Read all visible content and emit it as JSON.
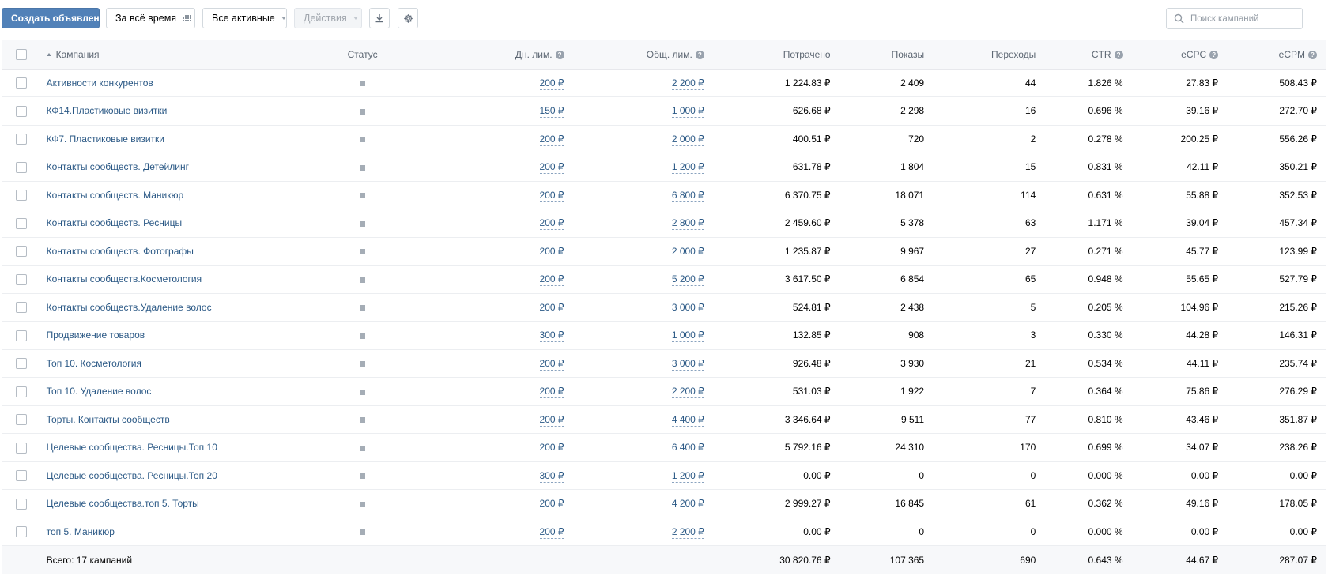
{
  "toolbar": {
    "create_label": "Создать объявление",
    "period_label": "За всё время",
    "filter_label": "Все активные",
    "actions_label": "Действия",
    "search_placeholder": "Поиск кампаний"
  },
  "colors": {
    "primary": "#5181b8",
    "link": "#2a5885",
    "header_bg": "#f7f8fa",
    "status_paused": "#a5adb6"
  },
  "icons": {
    "period": "calendar-grid-icon",
    "download": "download-icon",
    "settings": "gear-icon",
    "search": "search-icon",
    "help": "question-circle-icon",
    "sort": "sort-asc-icon"
  },
  "table": {
    "columns": {
      "campaign": "Кампания",
      "status": "Статус",
      "daily_limit": "Дн. лим.",
      "total_limit": "Общ. лим.",
      "spent": "Потрачено",
      "impressions": "Показы",
      "clicks": "Переходы",
      "ctr": "CTR",
      "ecpc": "eCPC",
      "ecpm": "eCPM"
    },
    "rows": [
      {
        "name": "Активности конкурентов",
        "daily": "200 ₽",
        "total": "2 200 ₽",
        "spent": "1 224.83 ₽",
        "impressions": "2 409",
        "clicks": "44",
        "ctr": "1.826 %",
        "ecpc": "27.83 ₽",
        "ecpm": "508.43 ₽"
      },
      {
        "name": "КФ14.Пластиковые визитки",
        "daily": "150 ₽",
        "total": "1 000 ₽",
        "spent": "626.68 ₽",
        "impressions": "2 298",
        "clicks": "16",
        "ctr": "0.696 %",
        "ecpc": "39.16 ₽",
        "ecpm": "272.70 ₽"
      },
      {
        "name": "КФ7. Пластиковые визитки",
        "daily": "200 ₽",
        "total": "2 000 ₽",
        "spent": "400.51 ₽",
        "impressions": "720",
        "clicks": "2",
        "ctr": "0.278 %",
        "ecpc": "200.25 ₽",
        "ecpm": "556.26 ₽"
      },
      {
        "name": "Контакты сообществ. Детейлинг",
        "daily": "200 ₽",
        "total": "1 200 ₽",
        "spent": "631.78 ₽",
        "impressions": "1 804",
        "clicks": "15",
        "ctr": "0.831 %",
        "ecpc": "42.11 ₽",
        "ecpm": "350.21 ₽"
      },
      {
        "name": "Контакты сообществ. Маникюр",
        "daily": "200 ₽",
        "total": "6 800 ₽",
        "spent": "6 370.75 ₽",
        "impressions": "18 071",
        "clicks": "114",
        "ctr": "0.631 %",
        "ecpc": "55.88 ₽",
        "ecpm": "352.53 ₽"
      },
      {
        "name": "Контакты сообществ. Ресницы",
        "daily": "200 ₽",
        "total": "2 800 ₽",
        "spent": "2 459.60 ₽",
        "impressions": "5 378",
        "clicks": "63",
        "ctr": "1.171 %",
        "ecpc": "39.04 ₽",
        "ecpm": "457.34 ₽"
      },
      {
        "name": "Контакты сообществ. Фотографы",
        "daily": "200 ₽",
        "total": "2 000 ₽",
        "spent": "1 235.87 ₽",
        "impressions": "9 967",
        "clicks": "27",
        "ctr": "0.271 %",
        "ecpc": "45.77 ₽",
        "ecpm": "123.99 ₽"
      },
      {
        "name": "Контакты сообществ.Косметология",
        "daily": "200 ₽",
        "total": "5 200 ₽",
        "spent": "3 617.50 ₽",
        "impressions": "6 854",
        "clicks": "65",
        "ctr": "0.948 %",
        "ecpc": "55.65 ₽",
        "ecpm": "527.79 ₽"
      },
      {
        "name": "Контакты сообществ.Удаление волос",
        "daily": "200 ₽",
        "total": "3 000 ₽",
        "spent": "524.81 ₽",
        "impressions": "2 438",
        "clicks": "5",
        "ctr": "0.205 %",
        "ecpc": "104.96 ₽",
        "ecpm": "215.26 ₽"
      },
      {
        "name": "Продвижение товаров",
        "daily": "300 ₽",
        "total": "1 000 ₽",
        "spent": "132.85 ₽",
        "impressions": "908",
        "clicks": "3",
        "ctr": "0.330 %",
        "ecpc": "44.28 ₽",
        "ecpm": "146.31 ₽"
      },
      {
        "name": "Топ 10. Косметология",
        "daily": "200 ₽",
        "total": "3 000 ₽",
        "spent": "926.48 ₽",
        "impressions": "3 930",
        "clicks": "21",
        "ctr": "0.534 %",
        "ecpc": "44.11 ₽",
        "ecpm": "235.74 ₽"
      },
      {
        "name": "Топ 10. Удаление волос",
        "daily": "200 ₽",
        "total": "2 200 ₽",
        "spent": "531.03 ₽",
        "impressions": "1 922",
        "clicks": "7",
        "ctr": "0.364 %",
        "ecpc": "75.86 ₽",
        "ecpm": "276.29 ₽"
      },
      {
        "name": "Торты. Контакты сообществ",
        "daily": "200 ₽",
        "total": "4 400 ₽",
        "spent": "3 346.64 ₽",
        "impressions": "9 511",
        "clicks": "77",
        "ctr": "0.810 %",
        "ecpc": "43.46 ₽",
        "ecpm": "351.87 ₽"
      },
      {
        "name": "Целевые сообщества. Ресницы.Топ 10",
        "daily": "200 ₽",
        "total": "6 400 ₽",
        "spent": "5 792.16 ₽",
        "impressions": "24 310",
        "clicks": "170",
        "ctr": "0.699 %",
        "ecpc": "34.07 ₽",
        "ecpm": "238.26 ₽"
      },
      {
        "name": "Целевые сообщества. Ресницы.Топ 20",
        "daily": "300 ₽",
        "total": "1 200 ₽",
        "spent": "0.00 ₽",
        "impressions": "0",
        "clicks": "0",
        "ctr": "0.000 %",
        "ecpc": "0.00 ₽",
        "ecpm": "0.00 ₽"
      },
      {
        "name": "Целевые сообщества.топ 5. Торты",
        "daily": "200 ₽",
        "total": "4 200 ₽",
        "spent": "2 999.27 ₽",
        "impressions": "16 845",
        "clicks": "61",
        "ctr": "0.362 %",
        "ecpc": "49.16 ₽",
        "ecpm": "178.05 ₽"
      },
      {
        "name": "топ 5. Маникюр",
        "daily": "200 ₽",
        "total": "2 200 ₽",
        "spent": "0.00 ₽",
        "impressions": "0",
        "clicks": "0",
        "ctr": "0.000 %",
        "ecpc": "0.00 ₽",
        "ecpm": "0.00 ₽"
      }
    ],
    "totals": {
      "label": "Всего: 17 кампаний",
      "spent": "30 820.76 ₽",
      "impressions": "107 365",
      "clicks": "690",
      "ctr": "0.643 %",
      "ecpc": "44.67 ₽",
      "ecpm": "287.07 ₽"
    }
  }
}
